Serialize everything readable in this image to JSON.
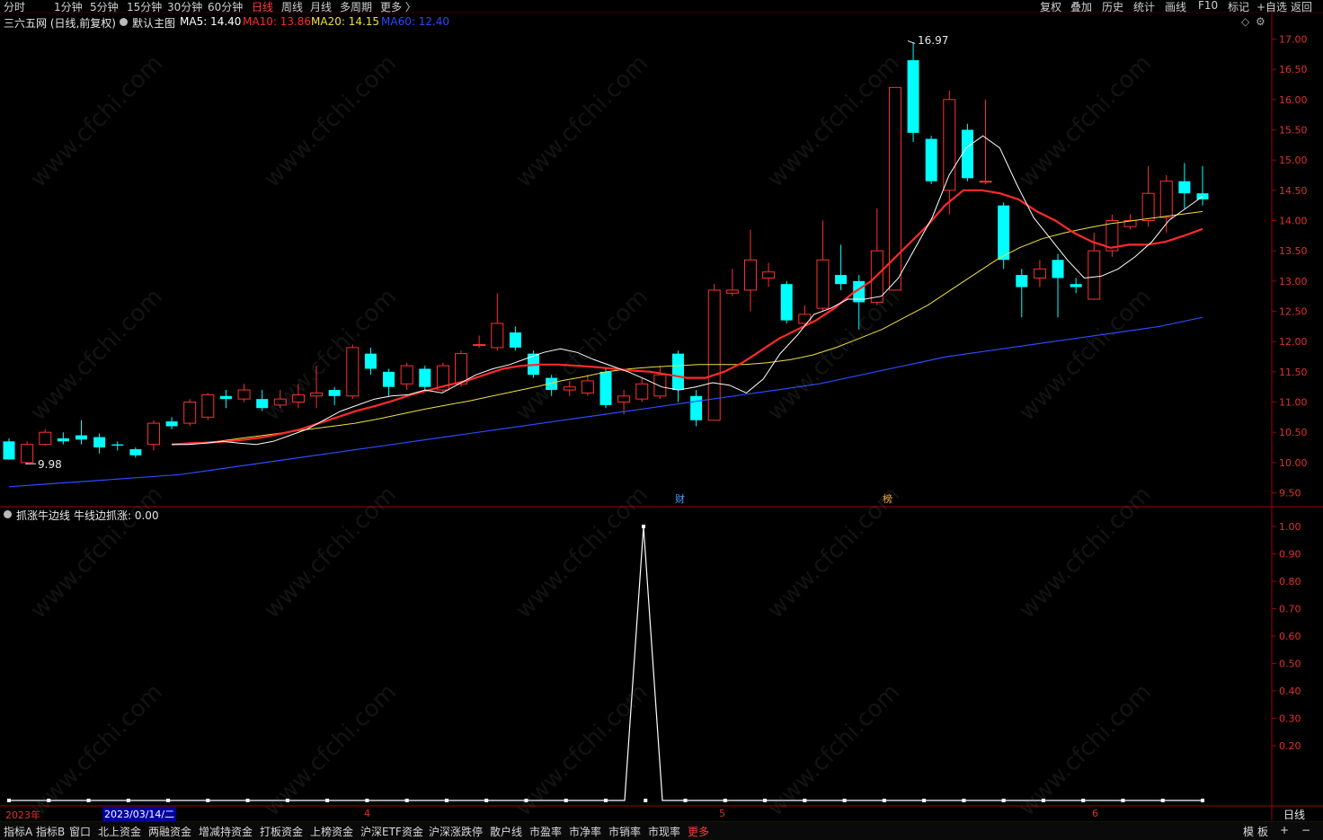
{
  "periods": [
    "分时",
    "1分钟",
    "5分钟",
    "15分钟",
    "30分钟",
    "60分钟",
    "日线",
    "周线",
    "月线",
    "多周期",
    "更多 〉"
  ],
  "active_period": "日线",
  "right_buttons": [
    "复权",
    "叠加",
    "历史",
    "统计",
    "画线",
    "F10",
    "标记",
    "+自选",
    "返回"
  ],
  "stock_title": "三六五网 (日线,前复权)",
  "main_chart_name": "默认主图",
  "ma": [
    {
      "label": "MA5: 14.40",
      "color": "#ffffff"
    },
    {
      "label": "MA10: 13.86",
      "color": "#ff2a2a"
    },
    {
      "label": "MA20: 14.15",
      "color": "#f0e040"
    },
    {
      "label": "MA60: 12.40",
      "color": "#2a4bff"
    }
  ],
  "sub_indicator": "抓涨牛边线",
  "sub_value": "牛线边抓涨: 0.00",
  "y_axis_main": [
    "17.00",
    "16.50",
    "16.00",
    "15.50",
    "15.00",
    "14.50",
    "14.00",
    "13.50",
    "13.00",
    "12.50",
    "12.00",
    "11.50",
    "11.00",
    "10.50",
    "10.00",
    "9.50"
  ],
  "y_axis_sub": [
    "1.00",
    "0.90",
    "0.80",
    "0.70",
    "0.60",
    "0.50",
    "0.40",
    "0.30",
    "0.20"
  ],
  "date_labels": [
    {
      "text": "2023年",
      "color": "#e03030"
    },
    {
      "text": "2023/03/14/二",
      "color": "#ffffff",
      "highlight": "#0000a0"
    },
    {
      "text": "4",
      "color": "#e03030"
    },
    {
      "text": "5",
      "color": "#e03030"
    },
    {
      "text": "6",
      "color": "#e03030"
    }
  ],
  "period_label": "日线",
  "high_mark": "16.97",
  "low_mark": "9.98",
  "badges": [
    {
      "text": "财",
      "color": "#4aa0ff"
    },
    {
      "text": "榜",
      "color": "#ffb040"
    }
  ],
  "bottom_tabs": [
    "指标A",
    "指标B",
    "窗口",
    "北上资金",
    "两融资金",
    "增减持资金",
    "打板资金",
    "上榜资金",
    "沪深ETF资金",
    "沪深涨跌停",
    "散户线",
    "市盈率",
    "市净率",
    "市销率",
    "市现率",
    "更多"
  ],
  "bottom_right": [
    "模",
    "板",
    "+",
    "−"
  ],
  "watermark": "www.cfchi.com",
  "chart_data": {
    "type": "candlestick",
    "y_range": [
      9.3,
      17.2
    ],
    "candles": [
      [
        10.35,
        10.05,
        10.4,
        10.05
      ],
      [
        10.0,
        10.3,
        10.35,
        9.98
      ],
      [
        10.3,
        10.5,
        10.55,
        10.28
      ],
      [
        10.4,
        10.35,
        10.5,
        10.3
      ],
      [
        10.45,
        10.38,
        10.7,
        10.3
      ],
      [
        10.42,
        10.25,
        10.48,
        10.15
      ],
      [
        10.3,
        10.28,
        10.35,
        10.2
      ],
      [
        10.22,
        10.12,
        10.25,
        10.08
      ],
      [
        10.3,
        10.65,
        10.7,
        10.2
      ],
      [
        10.68,
        10.6,
        10.75,
        10.55
      ],
      [
        10.65,
        11.0,
        11.05,
        10.6
      ],
      [
        10.75,
        11.12,
        11.15,
        10.7
      ],
      [
        11.1,
        11.05,
        11.2,
        10.9
      ],
      [
        11.05,
        11.2,
        11.3,
        11.0
      ],
      [
        11.05,
        10.9,
        11.2,
        10.85
      ],
      [
        10.95,
        11.05,
        11.2,
        10.9
      ],
      [
        11.0,
        11.12,
        11.3,
        10.9
      ],
      [
        11.1,
        11.15,
        11.6,
        10.9
      ],
      [
        11.2,
        11.1,
        11.25,
        10.95
      ],
      [
        11.1,
        11.9,
        11.95,
        11.05
      ],
      [
        11.8,
        11.55,
        11.9,
        11.45
      ],
      [
        11.5,
        11.25,
        11.55,
        11.1
      ],
      [
        11.3,
        11.6,
        11.65,
        11.2
      ],
      [
        11.55,
        11.25,
        11.6,
        11.2
      ],
      [
        11.2,
        11.6,
        11.65,
        11.15
      ],
      [
        11.3,
        11.8,
        11.85,
        11.25
      ],
      [
        11.95,
        11.95,
        12.1,
        11.9
      ],
      [
        11.9,
        12.3,
        12.8,
        11.85
      ],
      [
        12.15,
        11.9,
        12.25,
        11.85
      ],
      [
        11.8,
        11.45,
        11.85,
        11.4
      ],
      [
        11.4,
        11.2,
        11.45,
        11.1
      ],
      [
        11.2,
        11.25,
        11.35,
        11.1
      ],
      [
        11.15,
        11.35,
        11.45,
        11.1
      ],
      [
        11.5,
        10.95,
        11.55,
        10.9
      ],
      [
        11.0,
        11.1,
        11.2,
        10.8
      ],
      [
        11.05,
        11.3,
        11.4,
        11.0
      ],
      [
        11.1,
        11.45,
        11.6,
        11.05
      ],
      [
        11.8,
        11.2,
        11.85,
        11.0
      ],
      [
        11.1,
        10.7,
        11.2,
        10.6
      ],
      [
        10.7,
        12.85,
        12.95,
        10.7
      ],
      [
        12.8,
        12.85,
        13.2,
        12.75
      ],
      [
        12.85,
        13.35,
        13.85,
        12.5
      ],
      [
        13.05,
        13.15,
        13.3,
        12.9
      ],
      [
        12.95,
        12.35,
        13.0,
        12.3
      ],
      [
        12.3,
        12.45,
        12.6,
        12.25
      ],
      [
        12.55,
        13.35,
        14.0,
        12.5
      ],
      [
        13.1,
        12.95,
        13.6,
        12.85
      ],
      [
        13.0,
        12.65,
        13.1,
        12.2
      ],
      [
        12.65,
        13.5,
        14.2,
        12.6
      ],
      [
        12.85,
        16.2,
        16.2,
        12.85
      ],
      [
        16.65,
        15.45,
        16.95,
        15.3
      ],
      [
        15.35,
        14.65,
        15.4,
        14.6
      ],
      [
        14.5,
        16.0,
        16.15,
        14.1
      ],
      [
        15.5,
        14.7,
        15.6,
        14.65
      ],
      [
        14.65,
        14.65,
        16.0,
        14.6
      ],
      [
        14.25,
        13.35,
        14.3,
        13.2
      ],
      [
        13.1,
        12.9,
        13.2,
        12.4
      ],
      [
        13.05,
        13.2,
        13.35,
        12.9
      ],
      [
        13.35,
        13.05,
        13.45,
        12.4
      ],
      [
        12.95,
        12.9,
        13.05,
        12.8
      ],
      [
        12.7,
        13.5,
        13.8,
        12.7
      ],
      [
        13.5,
        14.0,
        14.1,
        13.4
      ],
      [
        13.9,
        14.0,
        14.1,
        13.85
      ],
      [
        14.0,
        14.45,
        14.9,
        13.9
      ],
      [
        14.05,
        14.65,
        14.75,
        13.8
      ],
      [
        14.65,
        14.45,
        14.95,
        14.2
      ],
      [
        14.45,
        14.35,
        14.9,
        14.25
      ]
    ],
    "ma_series": {
      "MA5": [
        10.3,
        10.3,
        10.32,
        10.35,
        10.32,
        10.3,
        10.35,
        10.45,
        10.55,
        10.7,
        10.85,
        10.95,
        11.05,
        11.1,
        11.12,
        11.2,
        11.15,
        11.3,
        11.45,
        11.55,
        11.62,
        11.72,
        11.82,
        11.88,
        11.82,
        11.7,
        11.6,
        11.5,
        11.38,
        11.25,
        11.2,
        11.25,
        11.32,
        11.28,
        11.15,
        11.38,
        11.8,
        12.1,
        12.45,
        12.55,
        12.7,
        12.7,
        12.75,
        13.05,
        13.55,
        14.05,
        14.75,
        15.2,
        15.4,
        15.2,
        14.6,
        14.05,
        13.7,
        13.35,
        13.05,
        13.08,
        13.2,
        13.4,
        13.65,
        14.0,
        14.2,
        14.4
      ],
      "MA10": [
        10.3,
        10.32,
        10.33,
        10.35,
        10.38,
        10.42,
        10.48,
        10.55,
        10.65,
        10.75,
        10.85,
        10.93,
        11.02,
        11.12,
        11.2,
        11.28,
        11.35,
        11.45,
        11.55,
        11.6,
        11.62,
        11.62,
        11.6,
        11.58,
        11.55,
        11.52,
        11.5,
        11.45,
        11.4,
        11.4,
        11.5,
        11.65,
        11.85,
        12.05,
        12.2,
        12.35,
        12.55,
        12.8,
        13.0,
        13.3,
        13.6,
        13.9,
        14.25,
        14.5,
        14.5,
        14.45,
        14.35,
        14.15,
        14.0,
        13.8,
        13.65,
        13.55,
        13.6,
        13.6,
        13.65,
        13.75,
        13.86
      ],
      "MA20": [
        10.3,
        10.32,
        10.35,
        10.4,
        10.45,
        10.5,
        10.55,
        10.6,
        10.65,
        10.72,
        10.8,
        10.88,
        10.95,
        11.02,
        11.1,
        11.18,
        11.26,
        11.35,
        11.42,
        11.5,
        11.55,
        11.58,
        11.6,
        11.62,
        11.62,
        11.62,
        11.65,
        11.7,
        11.78,
        11.9,
        12.05,
        12.2,
        12.4,
        12.6,
        12.85,
        13.1,
        13.35,
        13.55,
        13.7,
        13.8,
        13.88,
        13.95,
        14.0,
        14.05,
        14.1,
        14.15
      ],
      "MA60": [
        9.6,
        9.65,
        9.7,
        9.75,
        9.8,
        9.9,
        10.0,
        10.1,
        10.2,
        10.3,
        10.4,
        10.5,
        10.6,
        10.7,
        10.8,
        10.9,
        11.0,
        11.1,
        11.2,
        11.3,
        11.45,
        11.6,
        11.75,
        11.85,
        11.95,
        12.05,
        12.15,
        12.25,
        12.4
      ]
    },
    "sub_series": {
      "name": "牛线边抓涨",
      "spike_index": 34,
      "spike_value": 1.0
    }
  }
}
